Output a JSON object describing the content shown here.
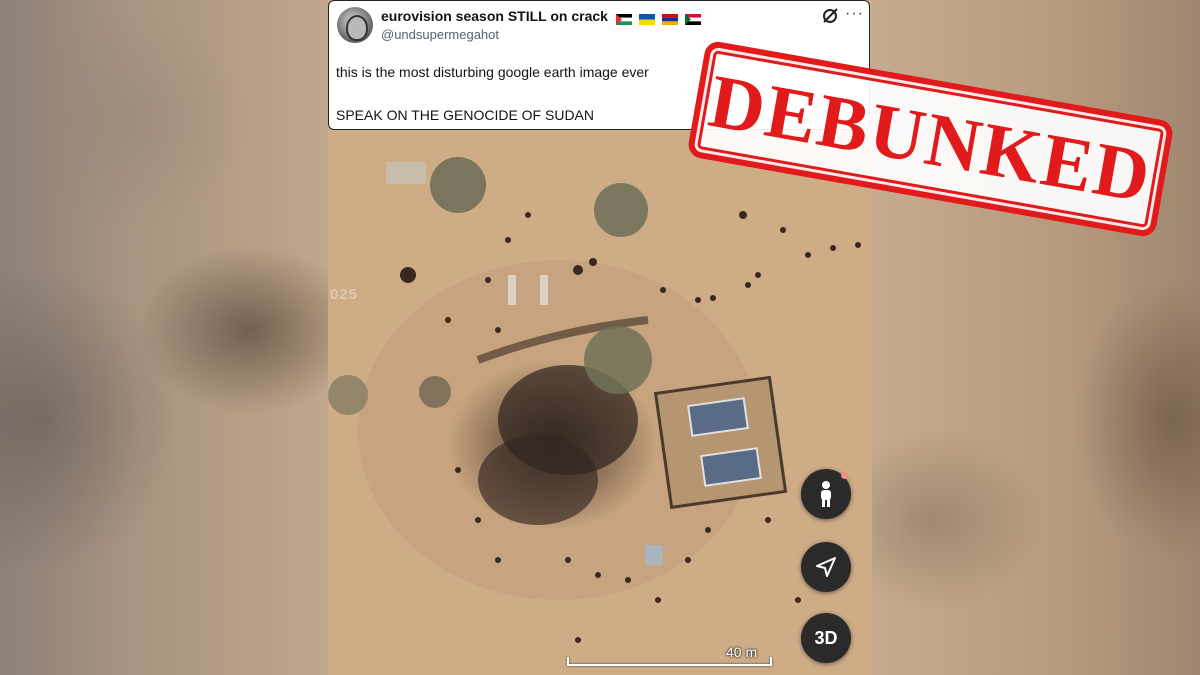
{
  "tweet": {
    "display_name": "eurovision season STILL on crack",
    "handle": "@undsupermegahot",
    "line1": "this is the most disturbing google earth image ever",
    "line2": "SPEAK ON THE GENOCIDE OF SUDAN",
    "flags": [
      "palestine-flag",
      "ukraine-flag",
      "armenia-flag",
      "sudan-flag"
    ]
  },
  "stamp": {
    "text": "DEBUNKED",
    "color": "#e11b1b"
  },
  "map": {
    "watermark": "025 ",
    "scale_label": "40 m",
    "btn_3d_label": "3D",
    "icons": [
      "pegman-icon",
      "navigation-arrow-icon"
    ]
  }
}
